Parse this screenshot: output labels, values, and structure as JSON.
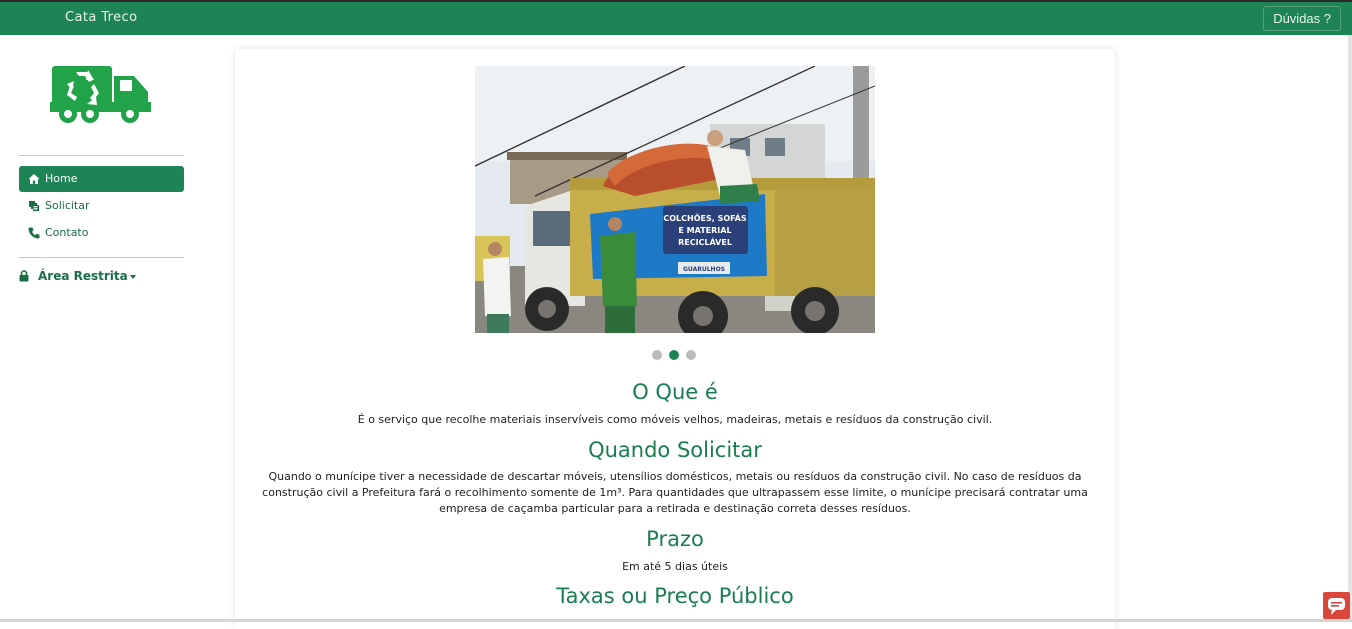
{
  "topbar": {
    "brand": "Cata Treco",
    "help_label": "Dúvidas ?"
  },
  "sidebar": {
    "logo_icon": "recycling-truck-icon",
    "items": [
      {
        "label": "Home",
        "icon": "home-icon",
        "active": true
      },
      {
        "label": "Solicitar",
        "icon": "request-icon",
        "active": false
      },
      {
        "label": "Contato",
        "icon": "phone-icon",
        "active": false
      }
    ],
    "restricted_label": "Área Restrita"
  },
  "carousel": {
    "banner_lines": [
      "COLCHÕES, SOFÁS",
      "E MATERIAL",
      "RECICLÁVEL"
    ],
    "banner_badge": "GUARULHOS",
    "slide_count": 3,
    "active_slide": 2
  },
  "sections": [
    {
      "title": "O Que é",
      "text": "É o serviço que recolhe materiais inservíveis como móveis velhos, madeiras, metais e resíduos da construção civil."
    },
    {
      "title": "Quando Solicitar",
      "lines": [
        "Quando o munícipe tiver a necessidade de descartar móveis, utensílios domésticos, metais ou resíduos da construção civil. No caso de resíduos da",
        "construção civil a Prefeitura fará o recolhimento somente de 1m³. Para quantidades que ultrapassem esse limite, o munícipe precisará contratar uma",
        "empresa de caçamba particular para a retirada e destinação correta desses resíduos."
      ]
    },
    {
      "title": "Prazo",
      "text": "Em até 5 dias úteis"
    },
    {
      "title": "Taxas ou Preço Público"
    }
  ],
  "colors": {
    "brand": "#1e8455",
    "heading": "#1a7d50",
    "chat": "#d9463b"
  }
}
